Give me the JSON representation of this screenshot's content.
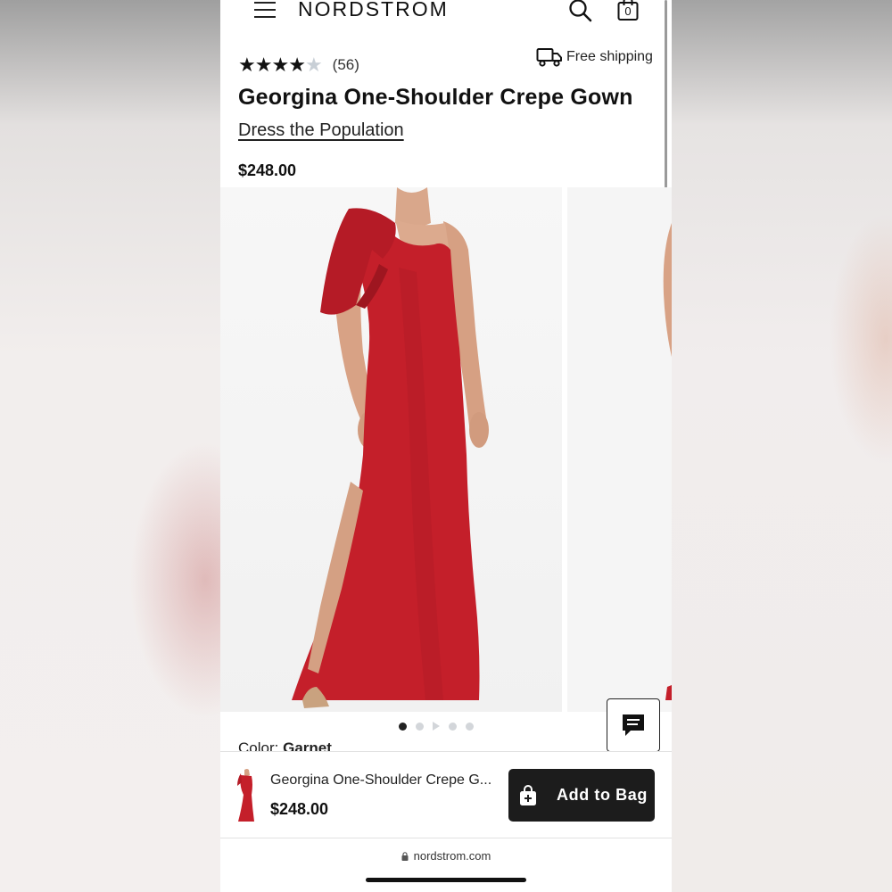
{
  "header": {
    "logo": "NORDSTROM",
    "bag_count": "0"
  },
  "product": {
    "rating_stars": 4,
    "rating_max": 5,
    "review_count": "(56)",
    "shipping_label": "Free shipping",
    "title": "Georgina One-Shoulder Crepe Gown",
    "brand": "Dress the Population",
    "price": "$248.00",
    "color_label": "Color:",
    "color_value": "Garnet",
    "dress_color": "#c41f2a"
  },
  "gallery": {
    "dot_count": 5,
    "active_index": 0
  },
  "sticky_bar": {
    "title": "Georgina One-Shoulder Crepe G...",
    "price": "$248.00",
    "add_to_bag_label": "Add to Bag"
  },
  "browser": {
    "url": "nordstrom.com"
  }
}
